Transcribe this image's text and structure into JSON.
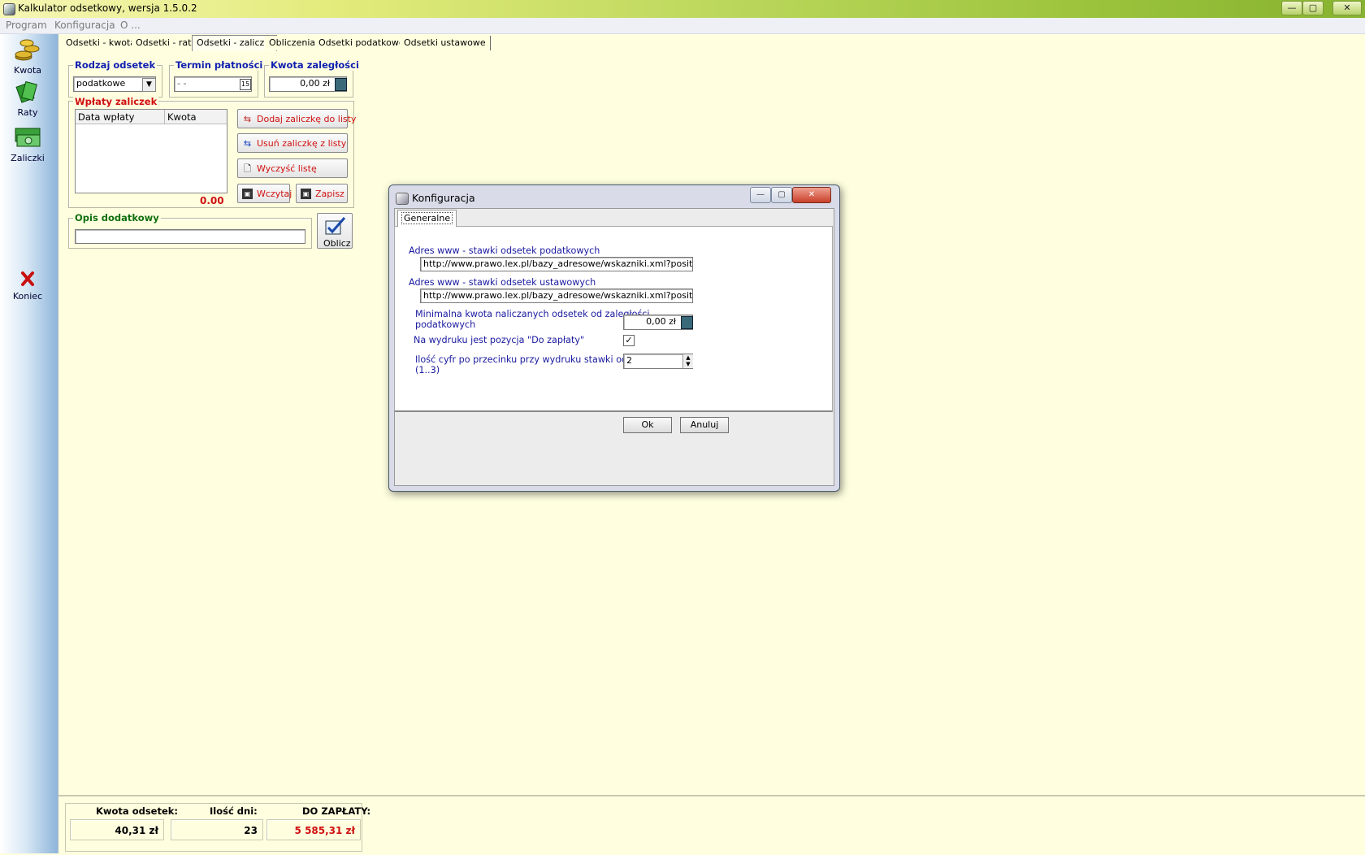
{
  "window": {
    "title": "Kalkulator odsetkowy, wersja 1.5.0.2",
    "controls": [
      "—",
      "▢",
      "✕"
    ]
  },
  "menu": [
    "Program",
    "Konfiguracja",
    "O ..."
  ],
  "toolbar": [
    {
      "label": "Kwota",
      "icon": "coins-icon"
    },
    {
      "label": "Raty",
      "icon": "money-stack-icon"
    },
    {
      "label": "Zaliczki",
      "icon": "banknotes-icon"
    },
    {
      "label": "Koniec",
      "icon": "close-x-icon"
    }
  ],
  "tabs": [
    "Odsetki - kwota",
    "Odsetki - raty",
    "Odsetki - zaliczki",
    "Obliczenia",
    "Odsetki podatkowe",
    "Odsetki ustawowe"
  ],
  "active_tab": "Odsetki - zaliczki",
  "form": {
    "rodzaj_title": "Rodzaj odsetek",
    "rodzaj_value": "podatkowe",
    "termin_title": "Termin płatności",
    "termin_value": "- -",
    "kwota_title": "Kwota zaległości",
    "kwota_value": "0,00 zł",
    "wplaty_title": "Wpłaty zaliczek",
    "list_headers": [
      "Data wpłaty",
      "Kwota"
    ],
    "list_rows": [],
    "sum": "0.00",
    "buttons": {
      "dodaj": "Dodaj zaliczkę do listy",
      "usun": "Usuń zaliczkę z listy",
      "wyczysc": "Wyczyść listę",
      "wczytaj": "Wczytaj",
      "zapisz": "Zapisz"
    },
    "opis_title": "Opis dodatkowy",
    "opis_value": "",
    "oblicz": "Oblicz"
  },
  "status": {
    "kwota_label": "Kwota odsetek:",
    "kwota_value": "40,31  zł",
    "dni_label": "Ilość dni:",
    "dni_value": "23",
    "zaplata_label": "DO ZAPŁATY:",
    "zaplata_value": "5 585,31  zł"
  },
  "dialog": {
    "title": "Konfiguracja",
    "tab": "Generalne",
    "podatkowe_label": "Adres www - stawki odsetek podatkowych",
    "podatkowe_url": "http://www.prawo.lex.pl/bazy_adresowe/wskazniki.xml?position=odse",
    "ustawowe_label": "Adres www - stawki odsetek ustawowych",
    "ustawowe_url": "http://www.prawo.lex.pl/bazy_adresowe/wskazniki.xml?position=odse",
    "min_label_1": "Minimalna kwota naliczanych odsetek od zaległości",
    "min_label_2": "podatkowych",
    "min_value": "0,00 zł",
    "wydruk_label": "Na wydruku jest pozycja \"Do zapłaty\"",
    "wydruk_checked": true,
    "cyfry_label_1": "Ilość cyfr po przecinku przy wydruku stawki odsetek",
    "cyfry_label_2": "(1..3)",
    "cyfry_value": "2",
    "ok": "Ok",
    "anuluj": "Anuluj"
  }
}
